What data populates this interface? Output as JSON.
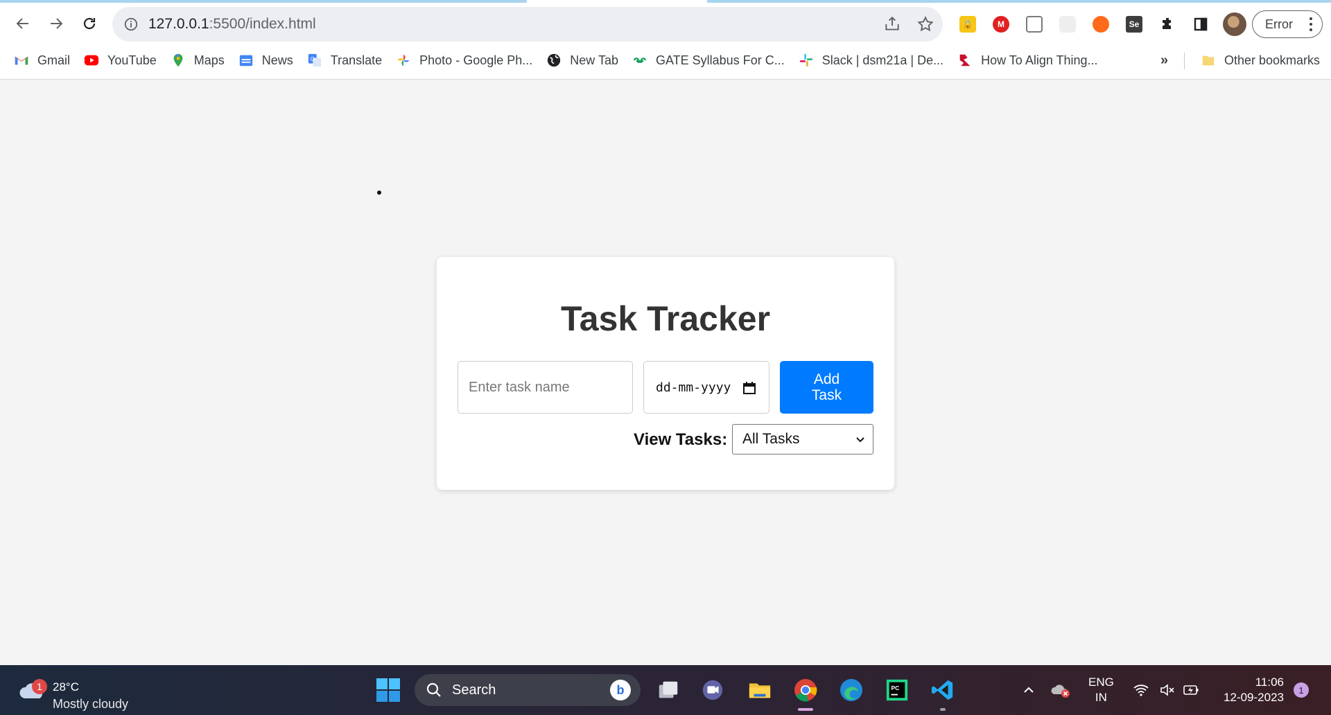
{
  "browser": {
    "url_host": "127.0.0.1",
    "url_path": ":5500/index.html",
    "error_chip_label": "Error",
    "bookmarks": [
      {
        "label": "Gmail",
        "icon": "gmail-icon"
      },
      {
        "label": "YouTube",
        "icon": "youtube-icon"
      },
      {
        "label": "Maps",
        "icon": "maps-icon"
      },
      {
        "label": "News",
        "icon": "news-icon"
      },
      {
        "label": "Translate",
        "icon": "translate-icon"
      },
      {
        "label": "Photo - Google Ph...",
        "icon": "photos-icon"
      },
      {
        "label": "New Tab",
        "icon": "globe-icon"
      },
      {
        "label": "GATE Syllabus For C...",
        "icon": "gate-icon"
      },
      {
        "label": "Slack | dsm21a | De...",
        "icon": "slack-icon"
      },
      {
        "label": "How To Align Thing...",
        "icon": "s-logo-icon"
      }
    ],
    "overflow_label": "»",
    "other_bookmarks_label": "Other bookmarks"
  },
  "app": {
    "title": "Task Tracker",
    "task_name_placeholder": "Enter task name",
    "date_placeholder": "dd-mm-yyyy",
    "add_button_label": "Add Task",
    "view_label": "View Tasks:",
    "view_selected": "All Tasks"
  },
  "taskbar": {
    "weather_badge": "1",
    "temperature": "28°C",
    "condition": "Mostly cloudy",
    "search_label": "Search",
    "lang_top": "ENG",
    "lang_bottom": "IN",
    "time": "11:06",
    "date": "12-09-2023",
    "notification_count": "1"
  },
  "colors": {
    "accent_button": "#007bff",
    "page_background": "#f4f4f4",
    "card_background": "#ffffff"
  }
}
